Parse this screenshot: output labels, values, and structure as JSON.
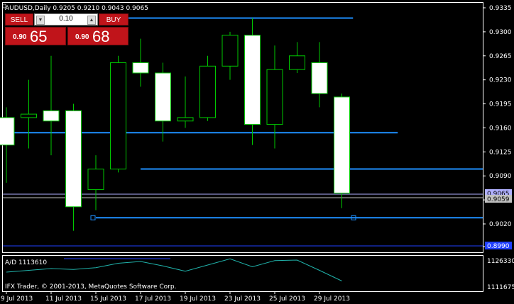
{
  "chart": {
    "header": "AUDUSD,Daily  0.9205 0.9210 0.9043 0.9065",
    "price_ticks": [
      "0.9335",
      "0.9300",
      "0.9265",
      "0.9230",
      "0.9195",
      "0.9160",
      "0.9125",
      "0.9090",
      "0.9055",
      "0.9020",
      "0.8990"
    ],
    "price_labels_boxed": [
      "0.9065",
      "0.9059"
    ],
    "bottom_price_tag": "0.8990",
    "date_ticks": [
      "9 Jul 2013",
      "11 Jul 2013",
      "15 Jul 2013",
      "17 Jul 2013",
      "19 Jul 2013",
      "23 Jul 2013",
      "25 Jul 2013",
      "29 Jul 2013"
    ],
    "indicator_label": "A/D 1113610",
    "indicator_ticks": [
      "1126330",
      "1111675"
    ],
    "copyright": "IFX Trader, © 2001-2013, MetaQuotes Software Corp.",
    "colors": {
      "background": "#000000",
      "candle_border": "#00c800",
      "bull_fill": "#000000",
      "bear_fill": "#ffffff",
      "line_color": "#1e90ff",
      "indicator_line": "#20b2aa",
      "trade_red": "#c0141a"
    }
  },
  "chart_data": {
    "type": "candlestick",
    "symbol": "AUDUSD",
    "timeframe": "Daily",
    "header_ohlc": {
      "open": 0.9205,
      "high": 0.921,
      "low": 0.9043,
      "close": 0.9065
    },
    "ylim": [
      0.898,
      0.9345
    ],
    "candles": [
      {
        "o": 0.9175,
        "h": 0.919,
        "l": 0.908,
        "c": 0.9135
      },
      {
        "o": 0.9175,
        "h": 0.923,
        "l": 0.913,
        "c": 0.918
      },
      {
        "o": 0.9185,
        "h": 0.9265,
        "l": 0.912,
        "c": 0.917
      },
      {
        "o": 0.9185,
        "h": 0.9195,
        "l": 0.901,
        "c": 0.9045
      },
      {
        "o": 0.907,
        "h": 0.912,
        "l": 0.904,
        "c": 0.91
      },
      {
        "o": 0.91,
        "h": 0.9265,
        "l": 0.9095,
        "c": 0.9255
      },
      {
        "o": 0.9255,
        "h": 0.929,
        "l": 0.922,
        "c": 0.924
      },
      {
        "o": 0.924,
        "h": 0.9255,
        "l": 0.914,
        "c": 0.917
      },
      {
        "o": 0.917,
        "h": 0.9235,
        "l": 0.916,
        "c": 0.9175
      },
      {
        "o": 0.9175,
        "h": 0.9265,
        "l": 0.917,
        "c": 0.925
      },
      {
        "o": 0.925,
        "h": 0.93,
        "l": 0.923,
        "c": 0.9295
      },
      {
        "o": 0.9295,
        "h": 0.932,
        "l": 0.9135,
        "c": 0.9165
      },
      {
        "o": 0.9165,
        "h": 0.928,
        "l": 0.913,
        "c": 0.9245
      },
      {
        "o": 0.9245,
        "h": 0.9285,
        "l": 0.924,
        "c": 0.9265
      },
      {
        "o": 0.9255,
        "h": 0.9285,
        "l": 0.919,
        "c": 0.921
      },
      {
        "o": 0.9205,
        "h": 0.921,
        "l": 0.9043,
        "c": 0.9065
      }
    ],
    "horizontal_lines": [
      {
        "price": 0.932,
        "from_index": 5,
        "to_index": 15.5
      },
      {
        "price": 0.9153,
        "from_index": -0.5,
        "to_index": 17.5
      },
      {
        "price": 0.91,
        "from_index": 6,
        "to_index": 22
      },
      {
        "price": 0.9029,
        "from_index": 4,
        "to_index": 22
      }
    ],
    "indicator": {
      "name": "A/D",
      "value": 1113610,
      "ylim": [
        1110000,
        1128000
      ],
      "values": [
        1120000,
        1121000,
        1122000,
        1121500,
        1122500,
        1125000,
        1126000,
        1123500,
        1120500,
        1124000,
        1127500,
        1123000,
        1126500,
        1126800,
        1121000,
        1115000
      ]
    }
  },
  "trade_panel": {
    "sell_label": "SELL",
    "buy_label": "BUY",
    "lot_value": "0.10",
    "down_arrow": "▼",
    "up_arrow": "▲",
    "sell_small": "0.90",
    "sell_big": "65",
    "buy_small": "0.90",
    "buy_big": "68"
  }
}
